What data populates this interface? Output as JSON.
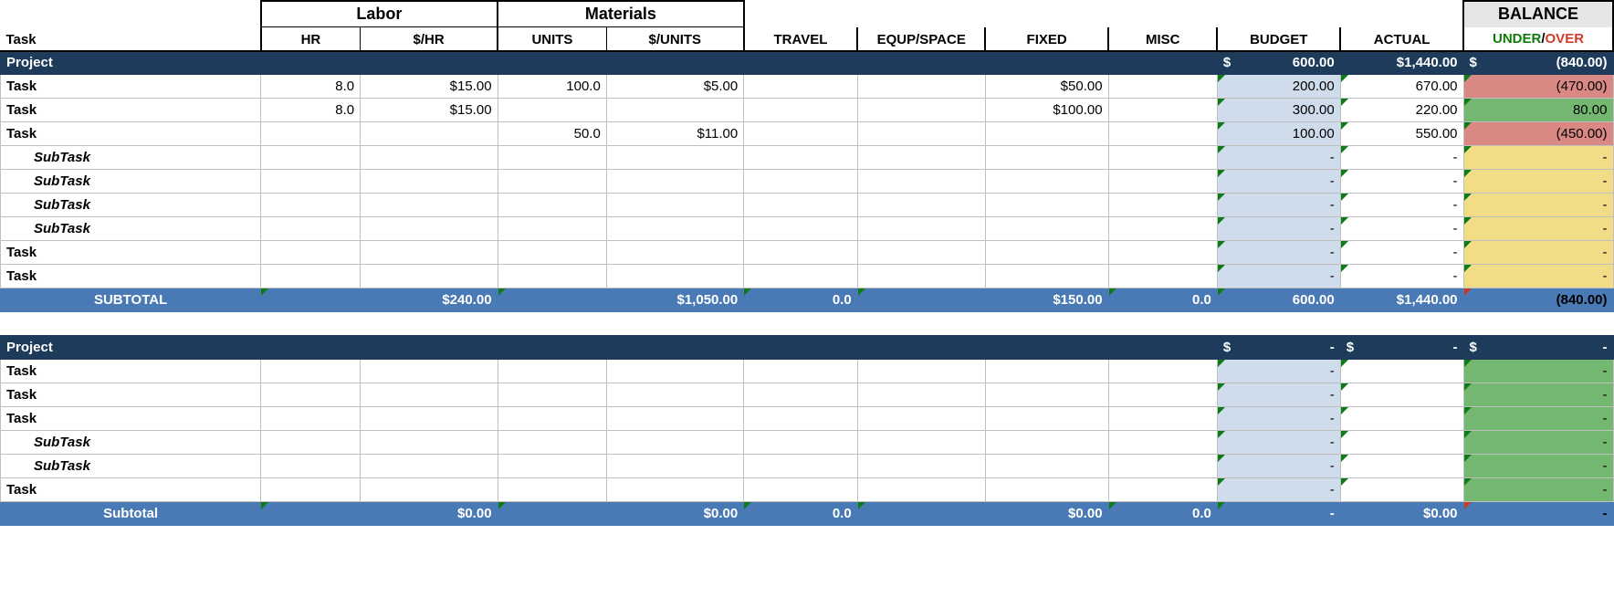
{
  "headers": {
    "task": "Task",
    "labor": "Labor",
    "hr": "HR",
    "per_hr": "$/HR",
    "materials": "Materials",
    "units": "UNITS",
    "per_unit": "$/UNITS",
    "travel": "TRAVEL",
    "equip": "EQUP/SPACE",
    "fixed": "FIXED",
    "misc": "MISC",
    "budget": "BUDGET",
    "actual": "ACTUAL",
    "balance": "BALANCE",
    "under": "UNDER",
    "slash": "/",
    "over": "OVER"
  },
  "sections": [
    {
      "project_label": "Project",
      "project_budget_prefix": "$",
      "project_budget": "600.00",
      "project_actual": "$1,440.00",
      "project_balance_prefix": "$",
      "project_balance": "(840.00)",
      "rows": [
        {
          "type": "task",
          "label": "Task",
          "hr": "8.0",
          "per_hr": "$15.00",
          "units": "100.0",
          "per_unit": "$5.00",
          "travel": "",
          "equip": "",
          "fixed": "$50.00",
          "misc": "",
          "budget": "200.00",
          "actual": "670.00",
          "balance": "(470.00)",
          "bal_color": "red"
        },
        {
          "type": "task",
          "label": "Task",
          "hr": "8.0",
          "per_hr": "$15.00",
          "units": "",
          "per_unit": "",
          "travel": "",
          "equip": "",
          "fixed": "$100.00",
          "misc": "",
          "budget": "300.00",
          "actual": "220.00",
          "balance": "80.00",
          "bal_color": "green"
        },
        {
          "type": "task",
          "label": "Task",
          "hr": "",
          "per_hr": "",
          "units": "50.0",
          "per_unit": "$11.00",
          "travel": "",
          "equip": "",
          "fixed": "",
          "misc": "",
          "budget": "100.00",
          "actual": "550.00",
          "balance": "(450.00)",
          "bal_color": "red"
        },
        {
          "type": "subtask",
          "label": "SubTask",
          "hr": "",
          "per_hr": "",
          "units": "",
          "per_unit": "",
          "travel": "",
          "equip": "",
          "fixed": "",
          "misc": "",
          "budget": "-",
          "actual": "-",
          "balance": "-",
          "bal_color": "yellow"
        },
        {
          "type": "subtask",
          "label": "SubTask",
          "hr": "",
          "per_hr": "",
          "units": "",
          "per_unit": "",
          "travel": "",
          "equip": "",
          "fixed": "",
          "misc": "",
          "budget": "-",
          "actual": "-",
          "balance": "-",
          "bal_color": "yellow"
        },
        {
          "type": "subtask",
          "label": "SubTask",
          "hr": "",
          "per_hr": "",
          "units": "",
          "per_unit": "",
          "travel": "",
          "equip": "",
          "fixed": "",
          "misc": "",
          "budget": "-",
          "actual": "-",
          "balance": "-",
          "bal_color": "yellow"
        },
        {
          "type": "subtask",
          "label": "SubTask",
          "hr": "",
          "per_hr": "",
          "units": "",
          "per_unit": "",
          "travel": "",
          "equip": "",
          "fixed": "",
          "misc": "",
          "budget": "-",
          "actual": "-",
          "balance": "-",
          "bal_color": "yellow"
        },
        {
          "type": "task",
          "label": "Task",
          "hr": "",
          "per_hr": "",
          "units": "",
          "per_unit": "",
          "travel": "",
          "equip": "",
          "fixed": "",
          "misc": "",
          "budget": "-",
          "actual": "-",
          "balance": "-",
          "bal_color": "yellow"
        },
        {
          "type": "task",
          "label": "Task",
          "hr": "",
          "per_hr": "",
          "units": "",
          "per_unit": "",
          "travel": "",
          "equip": "",
          "fixed": "",
          "misc": "",
          "budget": "-",
          "actual": "-",
          "balance": "-",
          "bal_color": "yellow"
        }
      ],
      "subtotal_label": "SUBTOTAL",
      "subtotal": {
        "per_hr": "$240.00",
        "per_unit": "$1,050.00",
        "travel": "0.0",
        "equip": "",
        "fixed": "$150.00",
        "misc": "0.0",
        "budget": "600.00",
        "actual": "$1,440.00",
        "balance": "(840.00)",
        "bal_text_color": "black"
      }
    },
    {
      "project_label": "Project",
      "project_budget_prefix": "$",
      "project_budget": "-",
      "project_actual_prefix": "$",
      "project_actual": "-",
      "project_balance_prefix": "$",
      "project_balance": "-",
      "rows": [
        {
          "type": "task",
          "label": "Task",
          "hr": "",
          "per_hr": "",
          "units": "",
          "per_unit": "",
          "travel": "",
          "equip": "",
          "fixed": "",
          "misc": "",
          "budget": "-",
          "actual": "",
          "balance": "-",
          "bal_color": "green"
        },
        {
          "type": "task",
          "label": "Task",
          "hr": "",
          "per_hr": "",
          "units": "",
          "per_unit": "",
          "travel": "",
          "equip": "",
          "fixed": "",
          "misc": "",
          "budget": "-",
          "actual": "",
          "balance": "-",
          "bal_color": "green"
        },
        {
          "type": "task",
          "label": "Task",
          "hr": "",
          "per_hr": "",
          "units": "",
          "per_unit": "",
          "travel": "",
          "equip": "",
          "fixed": "",
          "misc": "",
          "budget": "-",
          "actual": "",
          "balance": "-",
          "bal_color": "green"
        },
        {
          "type": "subtask",
          "label": "SubTask",
          "hr": "",
          "per_hr": "",
          "units": "",
          "per_unit": "",
          "travel": "",
          "equip": "",
          "fixed": "",
          "misc": "",
          "budget": "-",
          "actual": "",
          "balance": "-",
          "bal_color": "green"
        },
        {
          "type": "subtask",
          "label": "SubTask",
          "hr": "",
          "per_hr": "",
          "units": "",
          "per_unit": "",
          "travel": "",
          "equip": "",
          "fixed": "",
          "misc": "",
          "budget": "-",
          "actual": "",
          "balance": "-",
          "bal_color": "green"
        },
        {
          "type": "task",
          "label": "Task",
          "hr": "",
          "per_hr": "",
          "units": "",
          "per_unit": "",
          "travel": "",
          "equip": "",
          "fixed": "",
          "misc": "",
          "budget": "-",
          "actual": "",
          "balance": "-",
          "bal_color": "green"
        }
      ],
      "subtotal_label": "Subtotal",
      "subtotal": {
        "per_hr": "$0.00",
        "per_unit": "$0.00",
        "travel": "0.0",
        "equip": "",
        "fixed": "$0.00",
        "misc": "0.0",
        "budget": "-",
        "actual": "$0.00",
        "balance": "-",
        "bal_text_color": "black"
      }
    }
  ],
  "colors": {
    "under": "#0f7b0a",
    "over": "#d63a2a",
    "budget_bg": "#cfdcec",
    "bal_red": "#d98884",
    "bal_green": "#74b771",
    "bal_yellow": "#f2dd86",
    "project_bg": "#1f3b5c",
    "subtotal_bg": "#4a7ab5"
  }
}
